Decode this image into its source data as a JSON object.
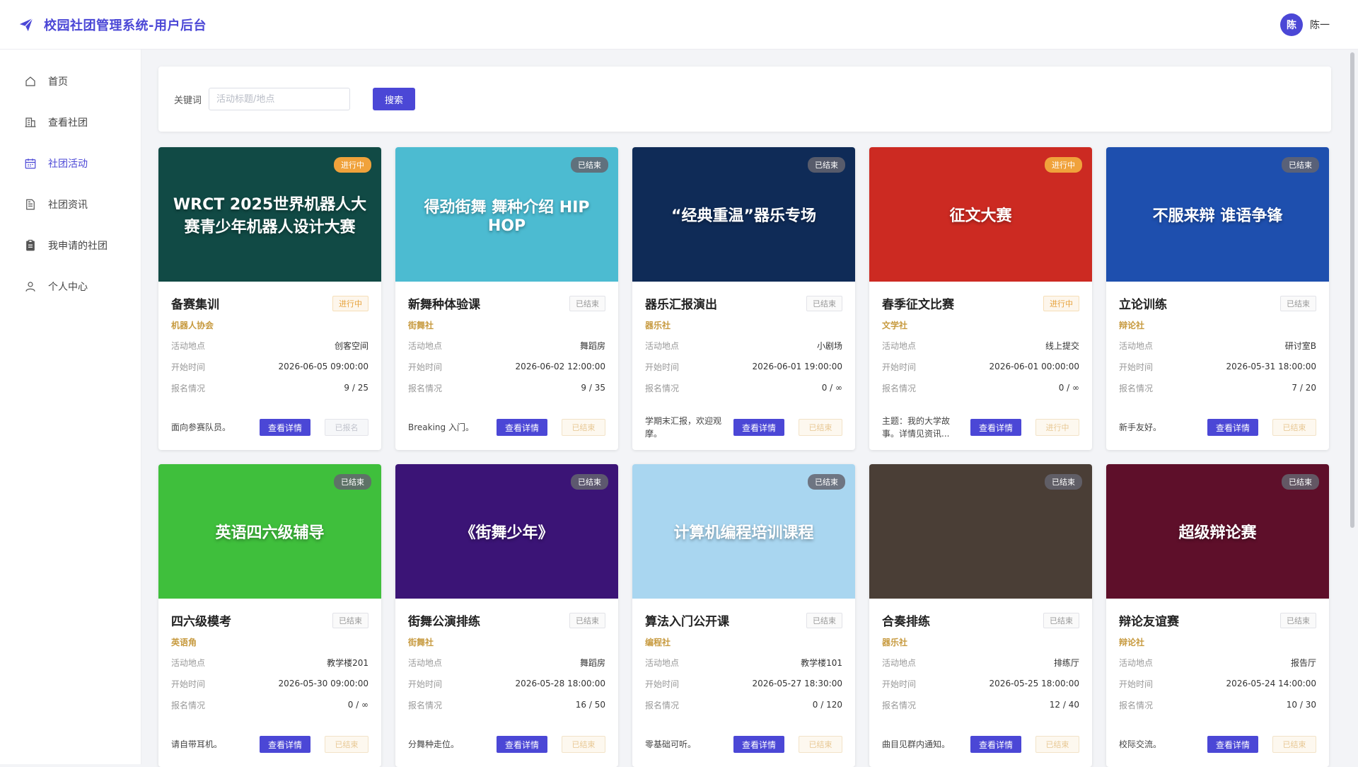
{
  "app": {
    "title": "校园社团管理系统-用户后台"
  },
  "user": {
    "avatar_char": "陈",
    "name": "陈一"
  },
  "sidebar": {
    "items": [
      {
        "label": "首页",
        "icon": "home-icon",
        "active": false
      },
      {
        "label": "查看社团",
        "icon": "building-icon",
        "active": false
      },
      {
        "label": "社团活动",
        "icon": "calendar-icon",
        "active": true
      },
      {
        "label": "社团资讯",
        "icon": "document-icon",
        "active": false
      },
      {
        "label": "我申请的社团",
        "icon": "clipboard-icon",
        "active": false
      },
      {
        "label": "个人中心",
        "icon": "user-icon",
        "active": false
      }
    ]
  },
  "search": {
    "label": "关键词",
    "placeholder": "活动标题/地点",
    "value": "",
    "button": "搜索"
  },
  "labels": {
    "location": "活动地点",
    "start": "开始时间",
    "signup": "报名情况",
    "detail": "查看详情"
  },
  "colors": {
    "accent": "#4b47d6",
    "ongoing": "#f0a23b",
    "club": "#c79a3f"
  },
  "activities": [
    {
      "title": "备赛集训",
      "status": "进行中",
      "club": "机器人协会",
      "location": "创客空间",
      "start": "2026-06-05 09:00:00",
      "signup": "9 / 25",
      "desc": "面向参赛队员。",
      "action": "已报名",
      "cover_text": "WRCT 2025世界机器人大赛青少年机器人设计大赛",
      "cover_bg": "#114a45"
    },
    {
      "title": "新舞种体验课",
      "status": "已结束",
      "club": "街舞社",
      "location": "舞蹈房",
      "start": "2026-06-02 12:00:00",
      "signup": "9 / 35",
      "desc": "Breaking 入门。",
      "action": "已结束",
      "cover_text": "得劲街舞 舞种介绍 HIP HOP",
      "cover_bg": "#4cbbd1"
    },
    {
      "title": "器乐汇报演出",
      "status": "已结束",
      "club": "器乐社",
      "location": "小剧场",
      "start": "2026-06-01 19:00:00",
      "signup": "0 / ∞",
      "desc": "学期末汇报，欢迎观摩。",
      "action": "已结束",
      "cover_text": "“经典重温”器乐专场",
      "cover_bg": "#0f2b57"
    },
    {
      "title": "春季征文比赛",
      "status": "进行中",
      "club": "文学社",
      "location": "线上提交",
      "start": "2026-06-01 00:00:00",
      "signup": "0 / ∞",
      "desc": "主题：我的大学故事。详情见资讯...",
      "action": "进行中",
      "cover_text": "征文大赛",
      "cover_bg": "#cc2a22"
    },
    {
      "title": "立论训练",
      "status": "已结束",
      "club": "辩论社",
      "location": "研讨室B",
      "start": "2026-05-31 18:00:00",
      "signup": "7 / 20",
      "desc": "新手友好。",
      "action": "已结束",
      "cover_text": "不服来辩 谁语争锋",
      "cover_bg": "#1e4fae"
    },
    {
      "title": "四六级模考",
      "status": "已结束",
      "club": "英语角",
      "location": "教学楼201",
      "start": "2026-05-30 09:00:00",
      "signup": "0 / ∞",
      "desc": "请自带耳机。",
      "action": "已结束",
      "cover_text": "英语四六级辅导",
      "cover_bg": "#3fbf3c"
    },
    {
      "title": "街舞公演排练",
      "status": "已结束",
      "club": "街舞社",
      "location": "舞蹈房",
      "start": "2026-05-28 18:00:00",
      "signup": "16 / 50",
      "desc": "分舞种走位。",
      "action": "已结束",
      "cover_text": "《街舞少年》",
      "cover_bg": "#3b1476"
    },
    {
      "title": "算法入门公开课",
      "status": "已结束",
      "club": "编程社",
      "location": "教学楼101",
      "start": "2026-05-27 18:30:00",
      "signup": "0 / 120",
      "desc": "零基础可听。",
      "action": "已结束",
      "cover_text": "计算机编程培训课程",
      "cover_bg": "#a9d6f0"
    },
    {
      "title": "合奏排练",
      "status": "已结束",
      "club": "器乐社",
      "location": "排练厅",
      "start": "2026-05-25 18:00:00",
      "signup": "12 / 40",
      "desc": "曲目见群内通知。",
      "action": "已结束",
      "cover_text": "",
      "cover_bg": "#4a3e36"
    },
    {
      "title": "辩论友谊赛",
      "status": "已结束",
      "club": "辩论社",
      "location": "报告厅",
      "start": "2026-05-24 14:00:00",
      "signup": "10 / 30",
      "desc": "校际交流。",
      "action": "已结束",
      "cover_text": "超级辩论赛",
      "cover_bg": "#5e0f2a"
    }
  ]
}
